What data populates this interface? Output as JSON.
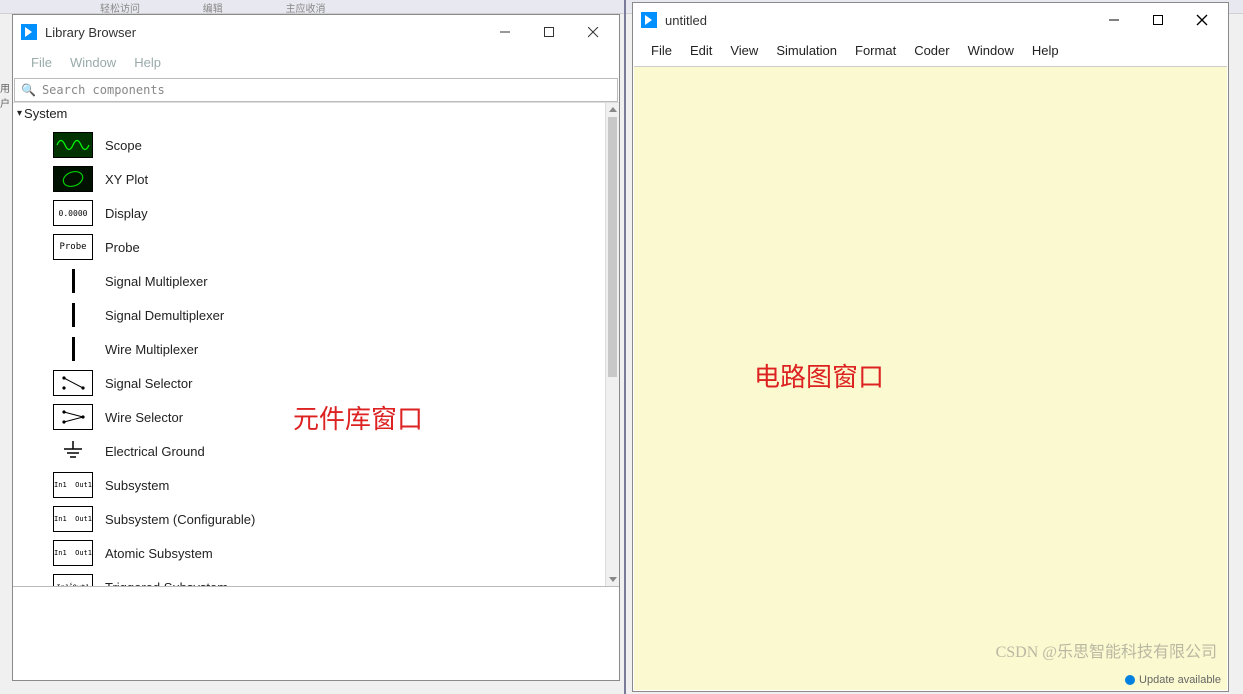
{
  "bg": {
    "tab1": "轻松访问",
    "tab2": "编辑",
    "tab3": "主应收消"
  },
  "left_window": {
    "title": "Library Browser",
    "menu": [
      "File",
      "Window",
      "Help"
    ],
    "search_placeholder": "Search components",
    "tree_root": "System",
    "items": [
      {
        "label": "Scope",
        "icon": "scope"
      },
      {
        "label": "XY Plot",
        "icon": "xy"
      },
      {
        "label": "Display",
        "icon": "display"
      },
      {
        "label": "Probe",
        "icon": "probe"
      },
      {
        "label": "Signal Multiplexer",
        "icon": "bar"
      },
      {
        "label": "Signal Demultiplexer",
        "icon": "bar"
      },
      {
        "label": "Wire Multiplexer",
        "icon": "bar"
      },
      {
        "label": "Signal Selector",
        "icon": "sel1"
      },
      {
        "label": "Wire Selector",
        "icon": "sel2"
      },
      {
        "label": "Electrical Ground",
        "icon": "ground"
      },
      {
        "label": "Subsystem",
        "icon": "sub"
      },
      {
        "label": "Subsystem (Configurable)",
        "icon": "sub"
      },
      {
        "label": "Atomic Subsystem",
        "icon": "sub"
      },
      {
        "label": "Triggered Subsystem",
        "icon": "subt"
      }
    ],
    "annotation": "元件库窗口"
  },
  "right_window": {
    "title": "untitled",
    "menu": [
      "File",
      "Edit",
      "View",
      "Simulation",
      "Format",
      "Coder",
      "Window",
      "Help"
    ],
    "annotation": "电路图窗口",
    "status": "Update available"
  },
  "watermark": "CSDN @乐思智能科技有限公司",
  "side_label": "用户"
}
